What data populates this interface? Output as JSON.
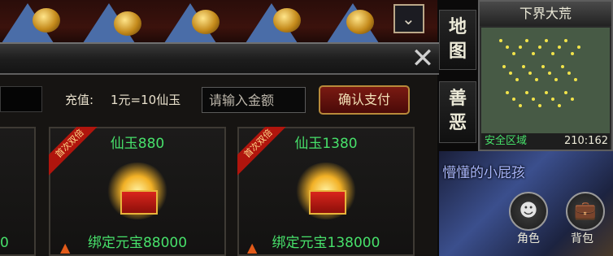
{
  "recharge": {
    "label": "充值:",
    "rate": "1元=10仙玉",
    "amount_placeholder": "请输入金额",
    "confirm_label": "确认支付"
  },
  "products": [
    {
      "badge": "首次双倍",
      "name": "仙玉880",
      "price": "绑定元宝88000"
    },
    {
      "badge": "首次双倍",
      "name": "仙玉1380",
      "price": "绑定元宝138000"
    }
  ],
  "partial_card": {
    "price_tail": "0"
  },
  "side_tabs": [
    {
      "label": "地\n图"
    },
    {
      "label": "善\n恶"
    }
  ],
  "minimap": {
    "title": "下界大荒",
    "zone": "安全区域",
    "coords": "210:162"
  },
  "player": {
    "name": "懵懂的小屁孩",
    "buttons": [
      {
        "label": "角色",
        "icon": "character-icon"
      },
      {
        "label": "背包",
        "icon": "bag-icon"
      }
    ]
  },
  "colors": {
    "accent_green": "#47e06a",
    "button_red": "#7a1a12",
    "gold_border": "#b88a3a"
  }
}
